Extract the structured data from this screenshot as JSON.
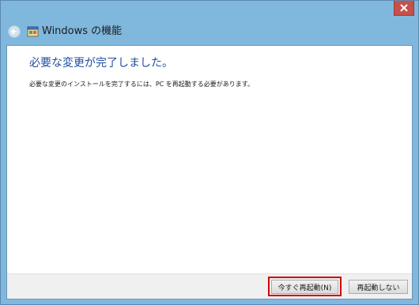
{
  "window": {
    "title": "Windows の機能",
    "app_icon": "windows-features-icon",
    "close_icon": "close-icon",
    "back_icon": "back-arrow-icon"
  },
  "main": {
    "heading": "必要な変更が完了しました。",
    "message": "必要な変更のインストールを完了するには、PC を再起動する必要があります。"
  },
  "buttons": {
    "restart_now": "今すぐ再起動(N)",
    "restart_later": "再起動しない"
  },
  "colors": {
    "frame": "#80b8dd",
    "close_button": "#c7504b",
    "heading_text": "#1f4e9c",
    "highlight_box": "#d00000"
  }
}
